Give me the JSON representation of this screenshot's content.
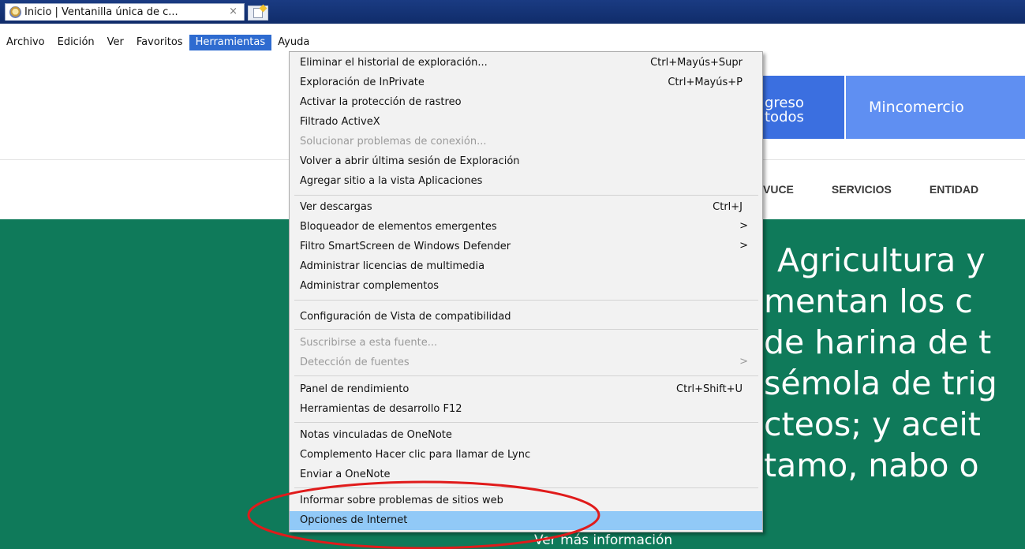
{
  "tab": {
    "title": "Inicio | Ventanilla única de c...",
    "close_glyph": "×"
  },
  "menubar": {
    "items": [
      "Archivo",
      "Edición",
      "Ver",
      "Favoritos",
      "Herramientas",
      "Ayuda"
    ],
    "active": "Herramientas"
  },
  "page": {
    "header_partial": "greso\ntodos",
    "mincomercio": "Mincomercio",
    "nav": [
      "VUCE",
      "SERVICIOS",
      "ENTIDAD"
    ],
    "hero_lines": [
      "Agricultura y",
      "mentan los c",
      "de harina de t",
      "sémola de trig",
      "cteos; y aceit",
      "tamo, nabo o"
    ],
    "more_link": "Ver más información",
    "hero_color": "#0f7a5a"
  },
  "tools_menu": {
    "items": [
      {
        "label": "Eliminar el historial de exploración...",
        "shortcut": "Ctrl+Mayús+Supr"
      },
      {
        "label": "Exploración de InPrivate",
        "shortcut": "Ctrl+Mayús+P"
      },
      {
        "label": "Activar la protección de rastreo"
      },
      {
        "label": "Filtrado ActiveX"
      },
      {
        "label": "Solucionar problemas de conexión...",
        "disabled": true
      },
      {
        "label": "Volver a abrir última sesión de Exploración"
      },
      {
        "label": "Agregar sitio a la vista Aplicaciones"
      },
      {
        "label": "Ver descargas",
        "shortcut": "Ctrl+J"
      },
      {
        "label": "Bloqueador de elementos emergentes",
        "arrow": ">"
      },
      {
        "label": "Filtro SmartScreen de Windows Defender",
        "arrow": ">"
      },
      {
        "label": "Administrar licencias de multimedia"
      },
      {
        "label": "Administrar complementos"
      },
      {
        "label": "Configuración de Vista de compatibilidad"
      },
      {
        "label": "Suscribirse a esta fuente...",
        "disabled": true
      },
      {
        "label": "Detección de fuentes",
        "disabled": true,
        "arrow": ">"
      },
      {
        "label": "Panel de rendimiento",
        "shortcut": "Ctrl+Shift+U"
      },
      {
        "label": "Herramientas de desarrollo F12"
      },
      {
        "label": "Notas vinculadas de OneNote"
      },
      {
        "label": "Complemento Hacer clic para llamar de Lync"
      },
      {
        "label": "Enviar a OneNote"
      },
      {
        "label": "Informar sobre problemas de sitios web"
      },
      {
        "label": "Opciones de Internet",
        "highlighted": true
      }
    ]
  },
  "annotation_color": "#e01b1b"
}
